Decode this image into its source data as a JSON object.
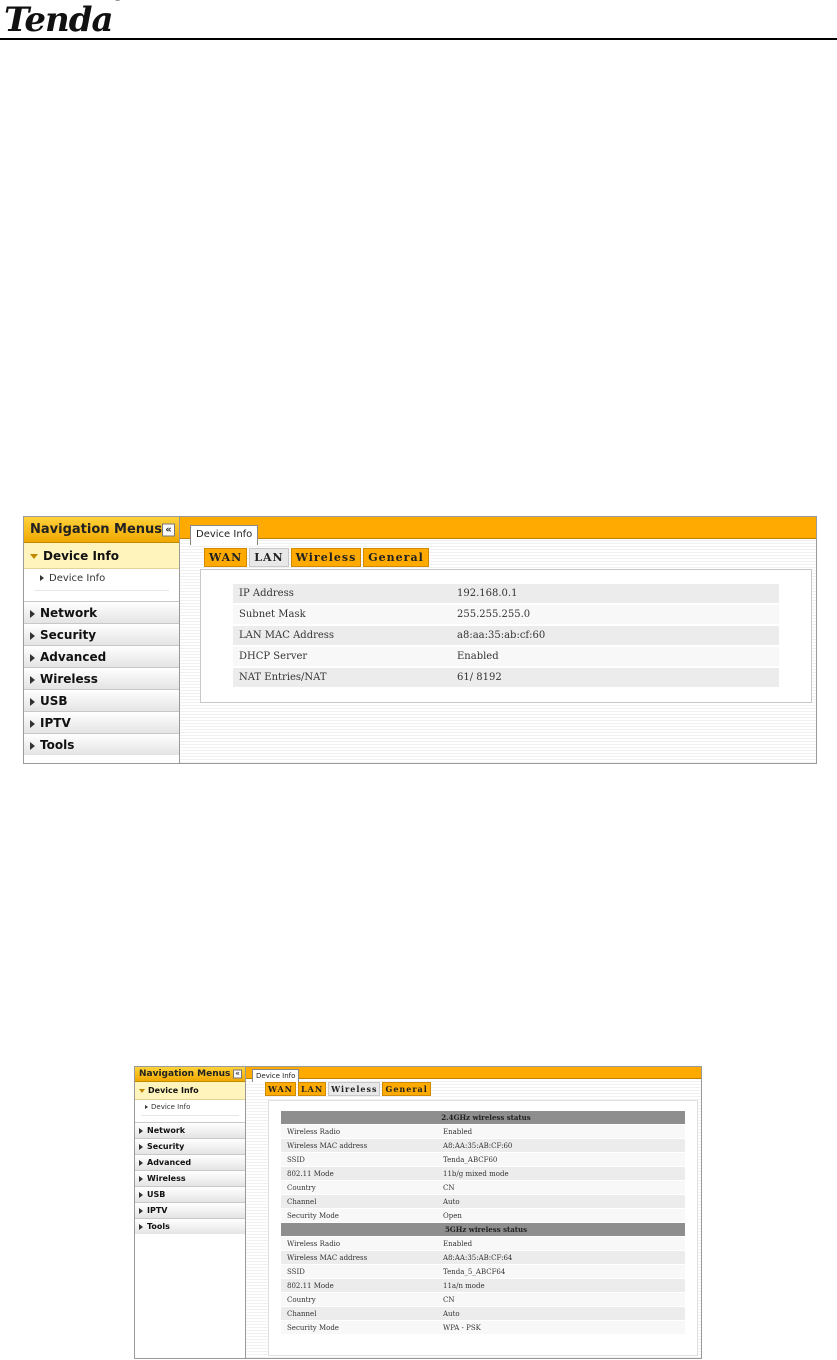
{
  "header": {
    "brand": "Tenda",
    "reg": "®"
  },
  "lan_screen": {
    "nav": {
      "title": "Navigation Menus",
      "collapse": "«",
      "section": "Device Info",
      "sub_item": "Device Info",
      "items": [
        "Network",
        "Security",
        "Advanced",
        "Wireless",
        "USB",
        "IPTV",
        "Tools"
      ]
    },
    "main_tab": "Device Info",
    "subtabs": [
      "WAN",
      "LAN",
      "Wireless",
      "General"
    ],
    "active_subtab": "LAN",
    "rows": [
      {
        "label": "IP Address",
        "value": "192.168.0.1"
      },
      {
        "label": "Subnet Mask",
        "value": "255.255.255.0"
      },
      {
        "label": "LAN MAC Address",
        "value": "a8:aa:35:ab:cf:60"
      },
      {
        "label": "DHCP Server",
        "value": "Enabled"
      },
      {
        "label": "NAT Entries/NAT",
        "value": "61/ 8192"
      }
    ]
  },
  "wireless_screen": {
    "nav": {
      "title": "Navigation Menus",
      "collapse": "«",
      "section": "Device Info",
      "sub_item": "Device Info",
      "items": [
        "Network",
        "Security",
        "Advanced",
        "Wireless",
        "USB",
        "IPTV",
        "Tools"
      ]
    },
    "main_tab": "Device Info",
    "subtabs": [
      "WAN",
      "LAN",
      "Wireless",
      "General"
    ],
    "active_subtab": "Wireless",
    "sections": [
      {
        "title": "2.4GHz wireless status",
        "rows": [
          {
            "label": "Wireless Radio",
            "value": "Enabled"
          },
          {
            "label": "Wireless MAC address",
            "value": "A8:AA:35:AB:CF:60"
          },
          {
            "label": "SSID",
            "value": "Tenda_ABCF60"
          },
          {
            "label": "802.11 Mode",
            "value": "11b/g mixed mode"
          },
          {
            "label": "Country",
            "value": "CN"
          },
          {
            "label": "Channel",
            "value": "Auto"
          },
          {
            "label": "Security Mode",
            "value": "Open"
          }
        ]
      },
      {
        "title": "5GHz wireless status",
        "rows": [
          {
            "label": "Wireless Radio",
            "value": "Enabled"
          },
          {
            "label": "Wireless MAC address",
            "value": "A8:AA:35:AB:CF:64"
          },
          {
            "label": "SSID",
            "value": "Tenda_5_ABCF64"
          },
          {
            "label": "802.11 Mode",
            "value": "11a/n mode"
          },
          {
            "label": "Country",
            "value": "CN"
          },
          {
            "label": "Channel",
            "value": "Auto"
          },
          {
            "label": "Security Mode",
            "value": "WPA - PSK"
          }
        ]
      }
    ]
  },
  "colors": {
    "accent": "#ffaa00",
    "nav_section_bg": "#fff4bb",
    "section_header_bg": "#8e8e8e"
  }
}
